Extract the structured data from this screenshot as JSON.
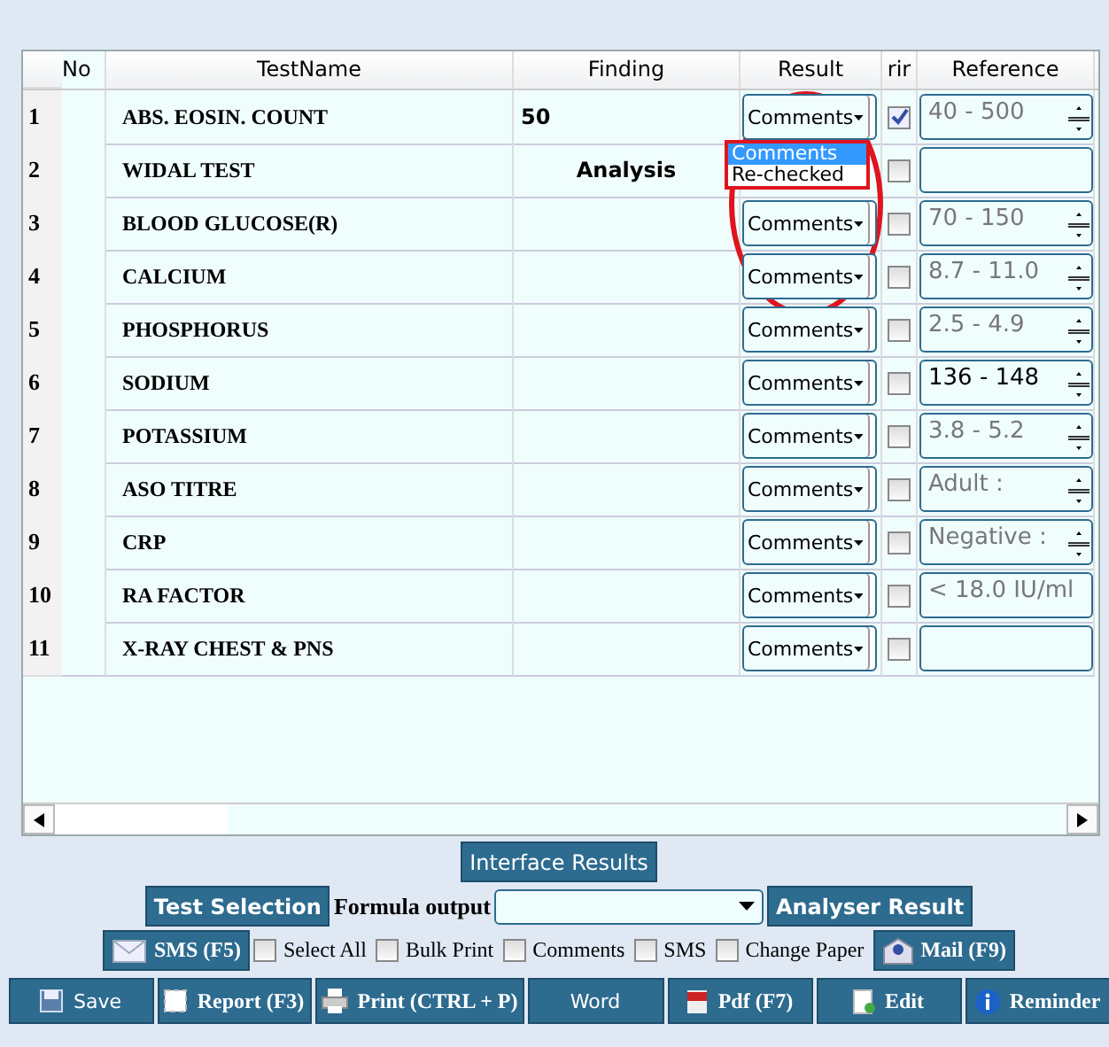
{
  "table": {
    "columns": [
      "No",
      "TestName",
      "Finding",
      "Result",
      "rir",
      "Reference"
    ],
    "rows": [
      {
        "kind": "entry",
        "number": "1",
        "test": "ABS. EOSIN. COUNT",
        "finding": "50",
        "result": "Comments",
        "checked": true,
        "reference": "40 - 500",
        "reference_muted": true,
        "spin": true,
        "open": false
      },
      {
        "kind": "section",
        "number": "2",
        "test": "WIDAL TEST",
        "finding": "Analysis",
        "checked": false,
        "spin": false,
        "open": true,
        "options": [
          {
            "label": "Comments",
            "selected": true
          },
          {
            "label": "Re-checked",
            "selected": false
          }
        ]
      },
      {
        "kind": "entry",
        "number": "3",
        "test": "BLOOD GLUCOSE(R)",
        "result": "Comments",
        "checked": false,
        "reference": "70 - 150",
        "reference_muted": true,
        "spin": true,
        "open": false
      },
      {
        "kind": "entry",
        "number": "4",
        "test": "CALCIUM",
        "result": "Comments",
        "checked": false,
        "reference": "8.7 - 11.0",
        "reference_muted": true,
        "spin": true,
        "open": false
      },
      {
        "kind": "entry",
        "number": "5",
        "test": "PHOSPHORUS",
        "result": "Comments",
        "checked": false,
        "reference": "2.5 - 4.9",
        "reference_muted": true,
        "spin": true,
        "open": false
      },
      {
        "kind": "entry",
        "number": "6",
        "test": "SODIUM",
        "result": "Comments",
        "checked": false,
        "reference": "136 - 148",
        "reference_muted": false,
        "spin": true,
        "open": false
      },
      {
        "kind": "entry",
        "number": "7",
        "test": "POTASSIUM",
        "result": "Comments",
        "checked": false,
        "reference": "3.8 - 5.2",
        "reference_muted": true,
        "spin": true,
        "open": false
      },
      {
        "kind": "entry",
        "number": "8",
        "test": "ASO TITRE",
        "result": "Comments",
        "checked": false,
        "reference": "Adult :",
        "reference_muted": true,
        "spin": true,
        "open": false
      },
      {
        "kind": "entry",
        "number": "9",
        "test": "CRP",
        "result": "Comments",
        "checked": false,
        "reference": "Negative :",
        "reference_muted": true,
        "spin": true,
        "open": false
      },
      {
        "kind": "entry",
        "number": "10",
        "test": "RA FACTOR",
        "result": "Comments",
        "checked": false,
        "reference": "< 18.0 IU/ml",
        "reference_muted": true,
        "spin": false,
        "open": false
      },
      {
        "kind": "entry",
        "number": "11",
        "test": "X-RAY CHEST & PNS",
        "result": "Comments",
        "checked": false,
        "spin": false,
        "open": false
      }
    ]
  },
  "interface_button": "Interface Results",
  "test_selection_button": "Test Selection",
  "formula_label": "Formula output",
  "analyser_button": "Analyser Result",
  "sms_button": "SMS (F5)",
  "options": [
    {
      "label": "Select All",
      "checked": false
    },
    {
      "label": "Bulk Print",
      "checked": false
    },
    {
      "label": "Comments",
      "checked": false
    },
    {
      "label": "SMS",
      "checked": false
    },
    {
      "label": "Change Paper",
      "checked": false
    }
  ],
  "mail_button": "Mail (F9)",
  "actions": [
    {
      "label": "Save",
      "kind": "save"
    },
    {
      "label": "Report (F3)",
      "kind": "report"
    },
    {
      "label": "Print (CTRL + P)",
      "kind": "print"
    },
    {
      "label": "Word",
      "kind": "none"
    },
    {
      "label": "Pdf (F7)",
      "kind": "pdf"
    },
    {
      "label": "Edit",
      "kind": "edit"
    },
    {
      "label": "Reminder",
      "kind": "info"
    }
  ]
}
